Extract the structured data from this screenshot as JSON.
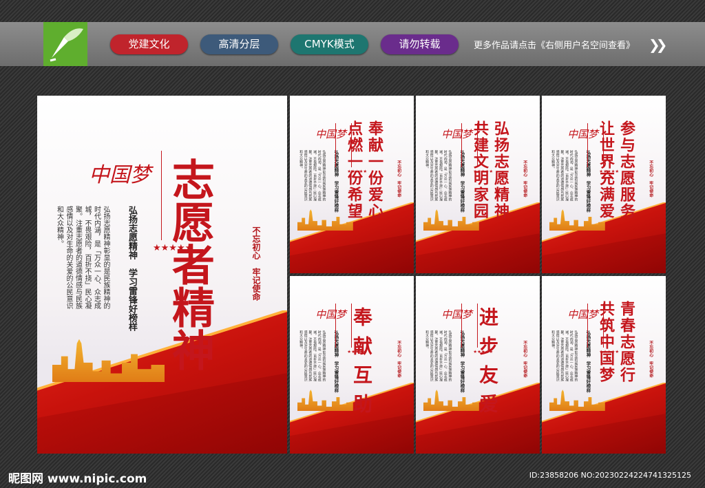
{
  "header": {
    "tags": [
      {
        "label": "党建文化",
        "color": "#c0242c"
      },
      {
        "label": "高清分层",
        "color": "#3d5a7a"
      },
      {
        "label": "CMYK模式",
        "color": "#1e7670"
      },
      {
        "label": "请勿转载",
        "color": "#6a2c8c"
      }
    ],
    "more_text": "更多作品请点击《右侧用户名空间查看》",
    "arrow": "❯❯"
  },
  "emblem_text": "中国梦",
  "subtitle": "弘扬志愿精神　学习雷锋好榜样",
  "body_text": "弘扬志愿精神彰显的是民族精神的时代内涵，是「万众一心、众志成城，不畏艰险，百折不挠」民心凝聚。注重志愿者的道德情感与民族感情以及对生命的关爱的公民意识和大众精神。",
  "seal_text": "不忘初心　牢记使命",
  "stars": "★★★★★",
  "main_poster": {
    "title": "志愿者精神"
  },
  "posters": [
    {
      "lines": [
        "奉献一份爱心",
        "点燃一份希望"
      ]
    },
    {
      "lines": [
        "弘扬志愿精神",
        "共建文明家园"
      ]
    },
    {
      "lines": [
        "参与志愿服务",
        "让世界充满爱"
      ]
    },
    {
      "lines": [
        "奉献互助"
      ]
    },
    {
      "lines": [
        "进步友爱"
      ]
    },
    {
      "lines": [
        "青春志愿行",
        "共筑中国梦"
      ]
    }
  ],
  "footer": {
    "site": "昵图网 www.nipic.com",
    "id": "ID:23858206 NO:20230224224741325125"
  }
}
